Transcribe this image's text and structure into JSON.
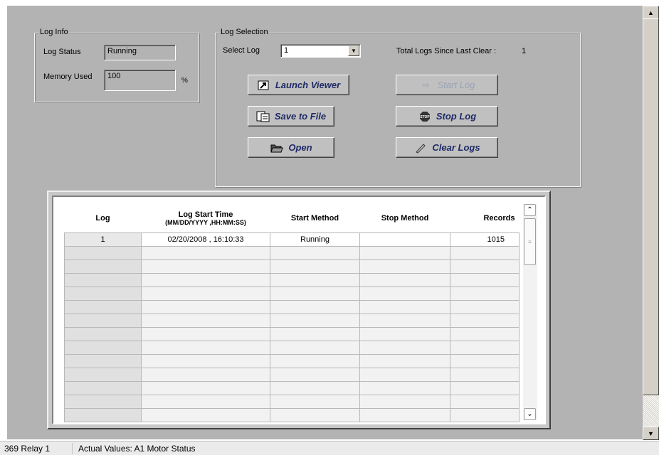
{
  "log_info": {
    "title": "Log Info",
    "status_label": "Log Status",
    "status_value": "Running",
    "memory_label": "Memory Used",
    "memory_value": "100",
    "memory_unit": "%"
  },
  "log_selection": {
    "title": "Log Selection",
    "select_label": "Select Log",
    "selected_log": "1",
    "total_label": "Total Logs Since Last Clear :",
    "total_value": "1",
    "buttons": {
      "launch_viewer": "Launch Viewer",
      "start_log": "Start Log",
      "save_to_file": "Save to File",
      "stop_log": "Stop Log",
      "open": "Open",
      "clear_logs": "Clear Logs"
    }
  },
  "table": {
    "headers": {
      "log": "Log",
      "start_time": "Log Start Time",
      "start_time_format": "(MM/DD/YYYY ,HH:MM:SS)",
      "start_method": "Start Method",
      "stop_method": "Stop Method",
      "records": "Records"
    },
    "rows": [
      {
        "log": "1",
        "start_time": "02/20/2008  ,  16:10:33",
        "start_method": "Running",
        "stop_method": "",
        "records": "1015"
      }
    ]
  },
  "status_bar": {
    "device": "369 Relay 1",
    "page": "Actual Values: A1 Motor Status"
  },
  "colors": {
    "panel_bg": "#b3b3b3",
    "button_text": "#1f2a66"
  }
}
